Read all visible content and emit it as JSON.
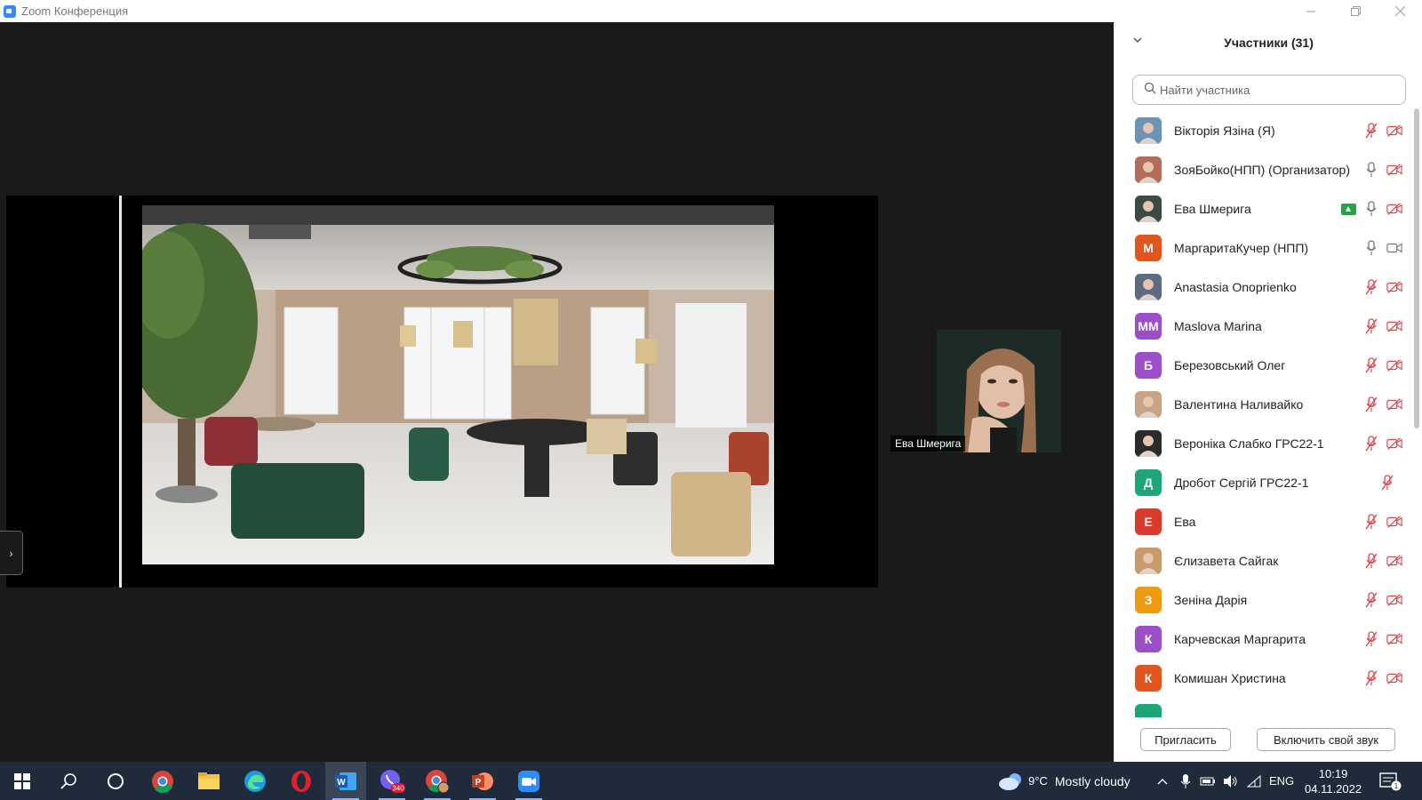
{
  "window": {
    "title": "Zoom Конференция"
  },
  "stage": {
    "thumbnail_label": "Ева Шмерига"
  },
  "participants_panel": {
    "title": "Участники (31)",
    "search_placeholder": "Найти участника",
    "participants": [
      {
        "name": "Вікторія Язіна (Я)",
        "avatar": "photo",
        "avatar_color": "#6a93b5",
        "mic": "muted",
        "video": "off",
        "share": false
      },
      {
        "name": "ЗояБойко(НПП) (Организатор)",
        "avatar": "photo",
        "avatar_color": "#b36d5b",
        "mic": "on",
        "video": "off",
        "share": false
      },
      {
        "name": "Ева Шмерига",
        "avatar": "photo",
        "avatar_color": "#3a4a44",
        "mic": "on",
        "video": "off",
        "share": true
      },
      {
        "name": "МаргаритаКучер  (НПП)",
        "avatar": "М",
        "avatar_color": "#e0561f",
        "mic": "on",
        "video": "on",
        "share": false
      },
      {
        "name": "Anastasia Onoprienko",
        "avatar": "photo",
        "avatar_color": "#5d6a80",
        "mic": "muted",
        "video": "off",
        "share": false
      },
      {
        "name": "Maslova Marina",
        "avatar": "ММ",
        "avatar_color": "#9b4fc9",
        "mic": "muted",
        "video": "off",
        "share": false
      },
      {
        "name": "Березовський Олег",
        "avatar": "Б",
        "avatar_color": "#9b4fc9",
        "mic": "muted",
        "video": "off",
        "share": false
      },
      {
        "name": "Валентина Наливайко",
        "avatar": "photo",
        "avatar_color": "#c7a487",
        "mic": "muted",
        "video": "off",
        "share": false
      },
      {
        "name": "Вероніка Слабко ГРС22-1",
        "avatar": "photo",
        "avatar_color": "#2b2b2b",
        "mic": "muted",
        "video": "off",
        "share": false
      },
      {
        "name": "Дробот Сергій ГРС22-1",
        "avatar": "Д",
        "avatar_color": "#1ea67a",
        "mic": "muted",
        "video": "none",
        "share": false
      },
      {
        "name": "Ева",
        "avatar": "Е",
        "avatar_color": "#d83b2b",
        "mic": "muted",
        "video": "off",
        "share": false
      },
      {
        "name": "Єлизавета Сайгак",
        "avatar": "photo",
        "avatar_color": "#c99a6b",
        "mic": "muted",
        "video": "off",
        "share": false
      },
      {
        "name": "Зеніна Дарія",
        "avatar": "З",
        "avatar_color": "#f09a12",
        "mic": "muted",
        "video": "off",
        "share": false
      },
      {
        "name": "Карчевская Маргарита",
        "avatar": "К",
        "avatar_color": "#9b4fc9",
        "mic": "muted",
        "video": "off",
        "share": false
      },
      {
        "name": "Комишан Христина",
        "avatar": "К",
        "avatar_color": "#e0561f",
        "mic": "muted",
        "video": "off",
        "share": false
      },
      {
        "name": "",
        "avatar": "",
        "avatar_color": "#1ea67a",
        "mic": "none",
        "video": "none",
        "share": false
      }
    ],
    "invite_button": "Пригласить",
    "unmute_button": "Включить свой звук"
  },
  "taskbar": {
    "weather_temp": "9°C",
    "weather_desc": "Mostly cloudy",
    "language": "ENG",
    "time": "10:19",
    "date": "04.11.2022",
    "viber_badge": "340",
    "notifications_badge": "1"
  },
  "colors": {
    "accent_blue": "#2d8cff",
    "muted_red": "#e0434b",
    "share_green": "#23a34a",
    "taskbar_bg": "#1f2a3a"
  }
}
